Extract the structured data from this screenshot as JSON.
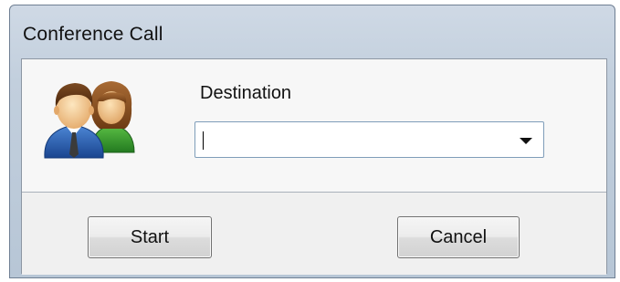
{
  "window": {
    "title": "Conference Call"
  },
  "icon": "users-icon",
  "destination": {
    "label": "Destination",
    "value": "",
    "dropdown_icon": "chevron-down-icon"
  },
  "buttons": {
    "start_label": "Start",
    "cancel_label": "Cancel"
  },
  "colors": {
    "title_bar": "#c2cfdd",
    "client_background": "#f6f6f6",
    "combo_border": "#7f9db9"
  }
}
